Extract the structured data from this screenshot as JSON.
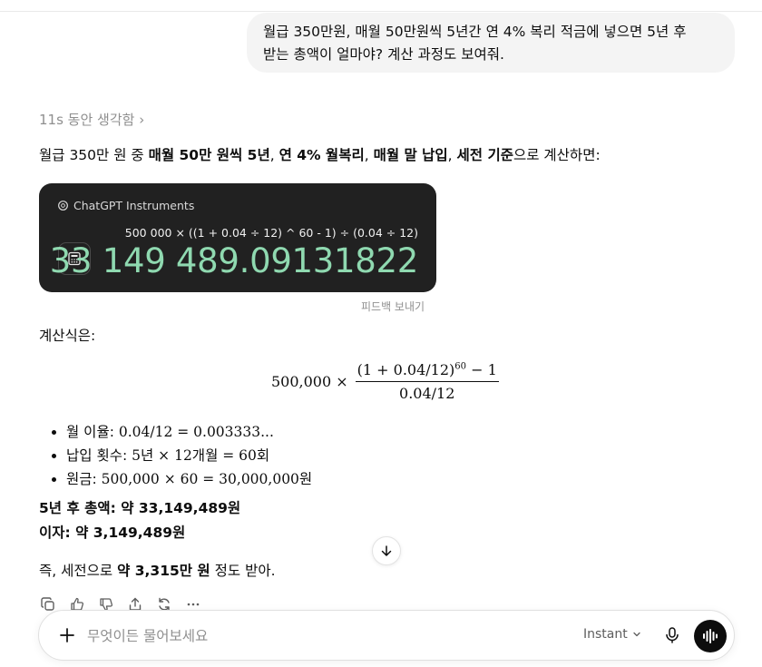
{
  "user_message": {
    "line1": "월급 350만원, 매월 50만원씩 5년간 연 4% 복리 적금에 넣으면 5년 후",
    "line2": "받는 총액이 얼마야? 계산 과정도 보여줘."
  },
  "assistant": {
    "thought_label": "11s 동안 생각함",
    "thought_chevron": "›",
    "intro": {
      "t1": "월급 350만 원 중 ",
      "b1": "매월 50만 원씩 5년",
      "t2": ", ",
      "b2": "연 4% 월복리",
      "t3": ", ",
      "b3": "매월 말 납입",
      "t4": ", ",
      "b4": "세전 기준",
      "t5": "으로 계산하면:"
    },
    "tool": {
      "name": "ChatGPT Instruments",
      "expression": "500 000 × ((1 + 0.04 ÷ 12) ^ 60 - 1) ÷ (0.04 ÷ 12)",
      "result": "33 149 489.09131822",
      "feedback": "피드백 보내기"
    },
    "formula_label": "계산식은:",
    "formula": {
      "lhs": "500,000 ×",
      "num_base": "(1 + 0.04/12)",
      "num_exp": "60",
      "num_tail": " − 1",
      "den": "0.04/12"
    },
    "bullets": [
      {
        "label": "월 이율: ",
        "math": "0.04/12 = 0.003333...",
        "suffix": ""
      },
      {
        "label": "납입 횟수: ",
        "math": "5년 × 12개월 = 60회",
        "suffix": ""
      },
      {
        "label": "원금: ",
        "math": "500,000 × 60 = 30,000,000",
        "suffix": "원"
      }
    ],
    "total_line": "5년 후 총액: 약 33,149,489원",
    "interest_line": "이자: 약 3,149,489원",
    "summary": {
      "t1": "즉, 세전으로 ",
      "b1": "약 3,315만 원",
      "t2": " 정도 받아."
    }
  },
  "composer": {
    "placeholder": "무엇이든 물어보세요",
    "model": "Instant"
  },
  "icons": [
    "plus-icon",
    "mic-icon",
    "voice-wave-icon",
    "calculator-icon",
    "arrow-down-icon",
    "copy-icon",
    "thumbs-up-icon",
    "thumbs-down-icon",
    "share-icon",
    "regenerate-icon",
    "more-icon",
    "chevron-down-icon"
  ]
}
